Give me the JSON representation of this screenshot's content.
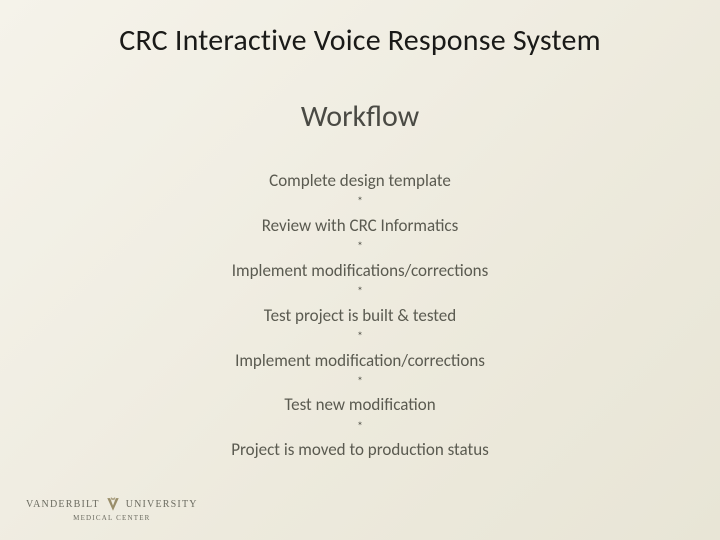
{
  "title": "CRC Interactive Voice Response System",
  "subtitle": "Workflow",
  "separator": "*",
  "steps": [
    "Complete design template",
    "Review with CRC Informatics",
    "Implement modifications/corrections",
    "Test project is built & tested",
    "Implement modification/corrections",
    "Test new modification",
    "Project is moved to production status"
  ],
  "footer": {
    "left": "VANDERBILT",
    "right": "UNIVERSITY",
    "sub": "MEDICAL CENTER"
  }
}
